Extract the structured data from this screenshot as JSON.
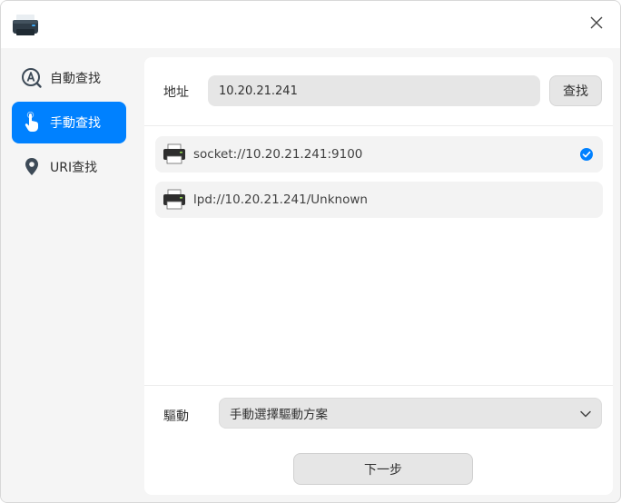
{
  "window": {
    "app_icon": "printer-app-icon",
    "close_icon": "close-icon"
  },
  "sidebar": {
    "items": [
      {
        "label": "自動查找",
        "icon": "auto-discover-icon",
        "active": false
      },
      {
        "label": "手動查找",
        "icon": "hand-pointer-icon",
        "active": true
      },
      {
        "label": "URI查找",
        "icon": "location-pin-icon",
        "active": false
      }
    ]
  },
  "address": {
    "label": "地址",
    "value": "10.20.21.241",
    "find_label": "查找"
  },
  "devices": [
    {
      "label": "socket://10.20.21.241:9100",
      "icon": "printer-icon",
      "selected": true
    },
    {
      "label": "lpd://10.20.21.241/Unknown",
      "icon": "printer-icon",
      "selected": false
    }
  ],
  "driver": {
    "label": "驅動",
    "selected": "手動選擇驅動方案",
    "icon": "chevron-down-icon"
  },
  "footer": {
    "next_label": "下一步"
  },
  "colors": {
    "accent": "#0081ff",
    "panel": "#ffffff",
    "background": "#f5f5f5"
  }
}
